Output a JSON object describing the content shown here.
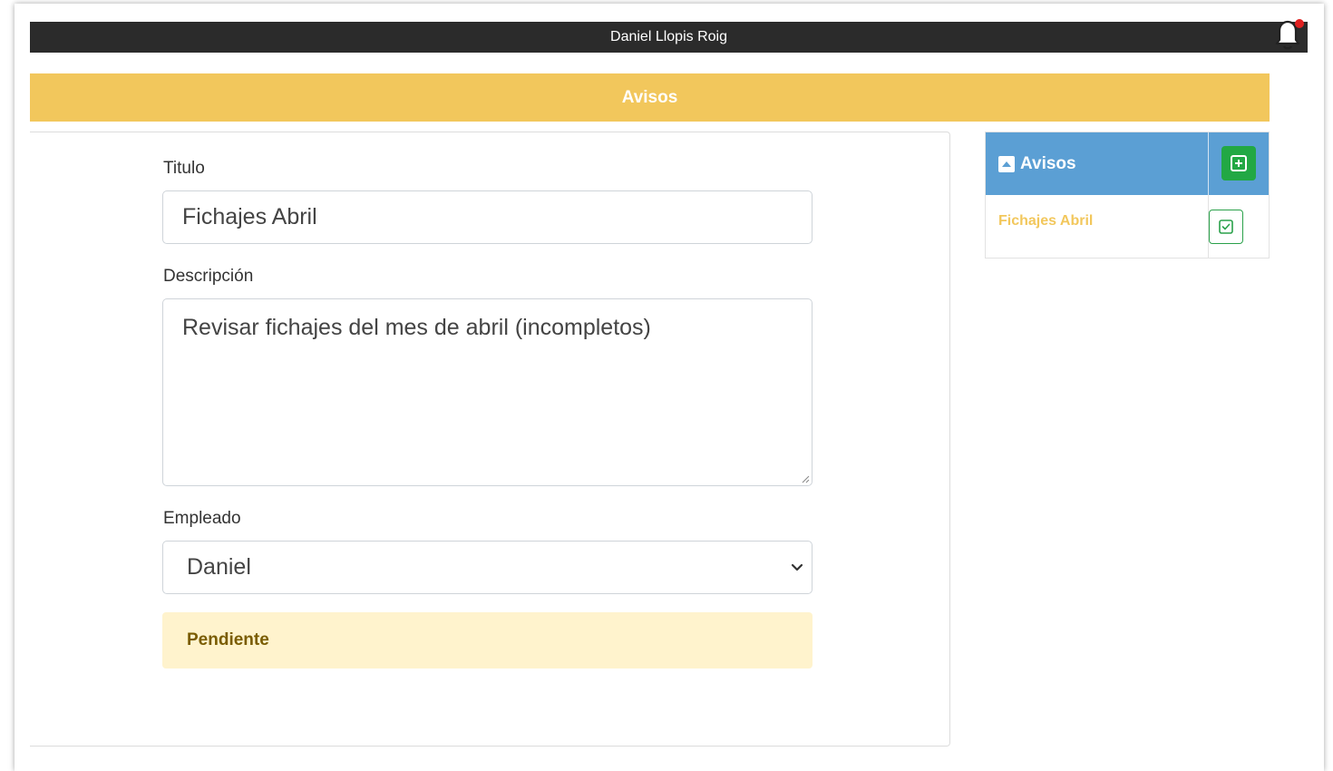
{
  "header": {
    "user_name": "Daniel Llopis Roig"
  },
  "banner": {
    "title": "Avisos"
  },
  "form": {
    "title_label": "Titulo",
    "title_value": "Fichajes Abril",
    "description_label": "Descripción",
    "description_value": "Revisar fichajes del mes de abril (incompletos)",
    "employee_label": "Empleado",
    "employee_value": "Daniel",
    "status_text": "Pendiente"
  },
  "sidebar": {
    "header_title": "Avisos",
    "items": [
      {
        "label": "Fichajes Abril"
      }
    ]
  },
  "icons": {
    "bell": "bell-icon",
    "collapse": "caret-square-up-icon",
    "add": "plus-square-icon",
    "check": "check-square-icon"
  },
  "colors": {
    "topbar": "#2b2b2b",
    "banner": "#f2c75c",
    "sidebar_header": "#5b9fd4",
    "add_button": "#22a844",
    "alert_bg": "#fff3cd",
    "alert_text": "#7a5c00"
  }
}
